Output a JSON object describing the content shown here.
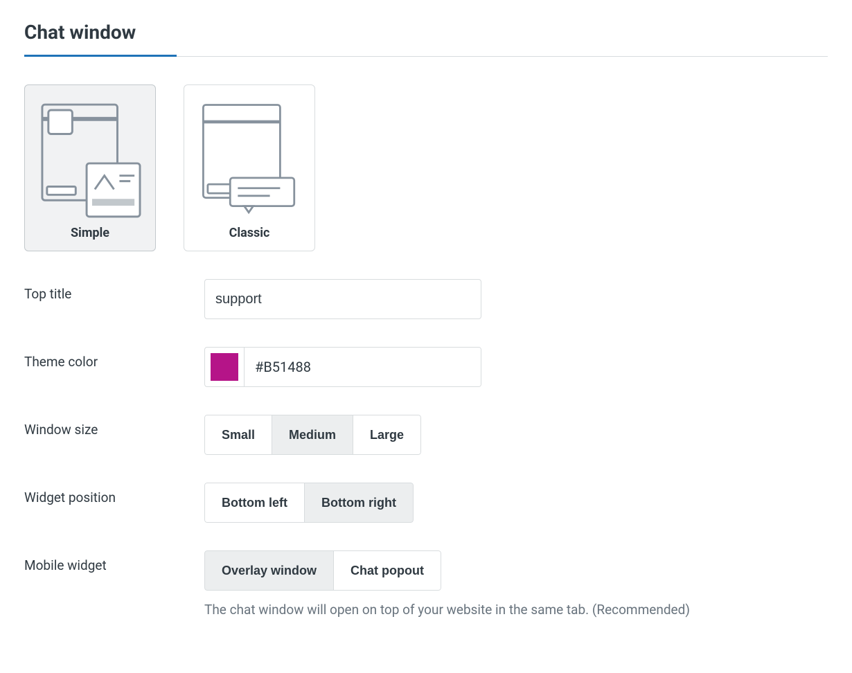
{
  "section": {
    "title": "Chat window"
  },
  "styles": {
    "options": [
      {
        "label": "Simple",
        "selected": true
      },
      {
        "label": "Classic",
        "selected": false
      }
    ]
  },
  "fields": {
    "top_title": {
      "label": "Top title",
      "value": "support"
    },
    "theme_color": {
      "label": "Theme color",
      "value": "#B51488",
      "swatch": "#B51488"
    },
    "window_size": {
      "label": "Window size",
      "options": [
        "Small",
        "Medium",
        "Large"
      ],
      "selected": "Medium"
    },
    "widget_position": {
      "label": "Widget position",
      "options": [
        "Bottom left",
        "Bottom right"
      ],
      "selected": "Bottom right"
    },
    "mobile_widget": {
      "label": "Mobile widget",
      "options": [
        "Overlay window",
        "Chat popout"
      ],
      "selected": "Overlay window",
      "help": "The chat window will open on top of your website in the same tab. (Recommended)"
    }
  }
}
